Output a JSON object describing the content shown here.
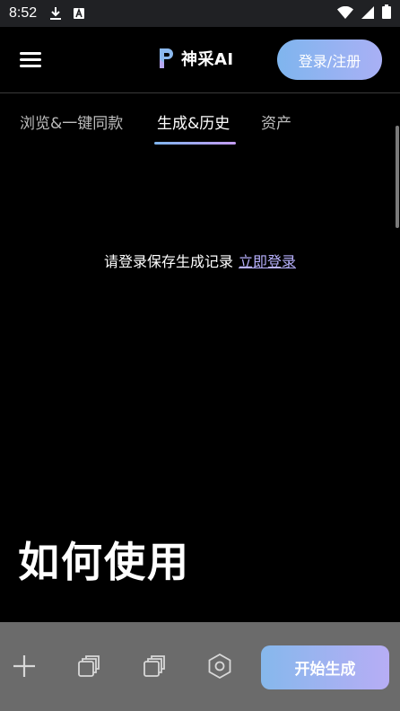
{
  "status_bar": {
    "time": "8:52",
    "icons": [
      "download-icon",
      "app-notification-icon",
      "wifi-icon",
      "signal-icon",
      "battery-icon"
    ]
  },
  "header": {
    "logo_text": "神采AI",
    "login_button": "登录/注册",
    "menu_icon": "menu-icon"
  },
  "tabs": [
    {
      "label": "浏览&一键同款",
      "active": false
    },
    {
      "label": "生成&历史",
      "active": true
    },
    {
      "label": "资产",
      "active": false
    }
  ],
  "main": {
    "login_prompt": "请登录保存生成记录",
    "login_link": "立即登录",
    "how_to_title": "如何使用"
  },
  "bottom_bar": {
    "tools": [
      "add-icon",
      "image-stack-icon",
      "image-stack-icon",
      "hexagon-settings-icon"
    ],
    "generate_button": "开始生成"
  },
  "colors": {
    "accent_start": "#7fb5ee",
    "accent_end": "#b7adf5",
    "link": "#b9b2ff",
    "background": "#000000",
    "bottom_bar": "#6b6b6b"
  }
}
